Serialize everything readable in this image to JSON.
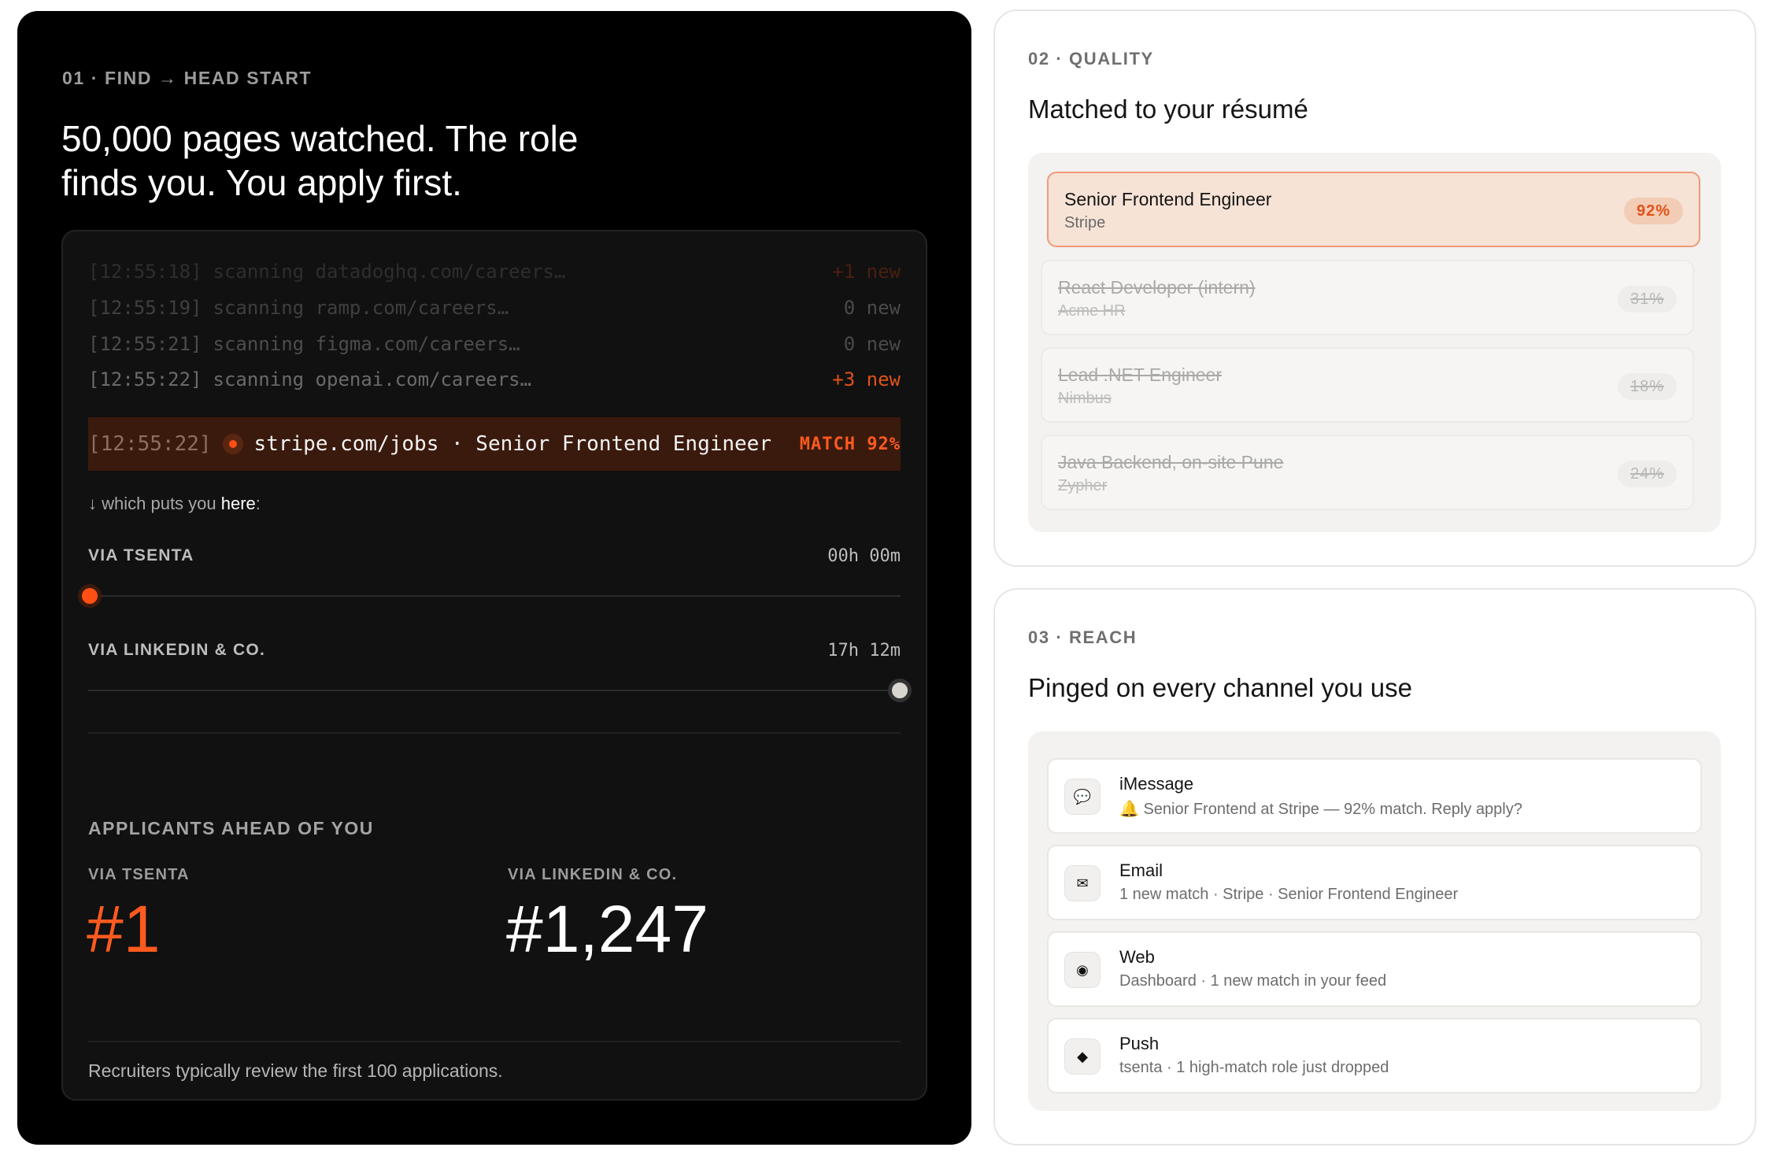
{
  "finder": {
    "eyebrow": "01 · FIND → HEAD START",
    "title": "50,000 pages watched. The role finds you. You apply first.",
    "log": [
      {
        "time": "[12:55:18]",
        "text": "scanning datadoghq.com/careers…",
        "result": "+1 new"
      },
      {
        "time": "[12:55:19]",
        "text": "scanning ramp.com/careers…",
        "result": "0 new"
      },
      {
        "time": "[12:55:21]",
        "text": "scanning figma.com/careers…",
        "result": "0 new"
      },
      {
        "time": "[12:55:22]",
        "text": "scanning openai.com/careers…",
        "result": "+3 new"
      }
    ],
    "hit": {
      "time": "[12:55:22]",
      "text": "stripe.com/jobs · Senior Frontend Engineer",
      "badge": "MATCH 92%"
    },
    "puts_prefix": "↓ which puts you ",
    "puts_here": "here",
    "puts_suffix": ":",
    "timeline": [
      {
        "label": "VIA TSENTA",
        "time": "00h 00m"
      },
      {
        "label": "VIA LINKEDIN & CO.",
        "time": "17h 12m"
      }
    ],
    "applicants_title": "APPLICANTS AHEAD OF YOU",
    "ranks": [
      {
        "label": "VIA TSENTA",
        "value": "#1"
      },
      {
        "label": "VIA LINKEDIN & CO.",
        "value": "#1,247"
      }
    ],
    "footnote": "Recruiters typically review the first 100 applications.",
    "colors": {
      "accent": "#ff5a1f",
      "background": "#000000",
      "panel": "#111111"
    }
  },
  "quality": {
    "eyebrow": "02 · QUALITY",
    "title": "Matched to your résumé",
    "matches": [
      {
        "title": "Senior Frontend Engineer",
        "company": "Stripe",
        "score": "92%"
      },
      {
        "title": "React Developer (intern)",
        "company": "Acme HR",
        "score": "31%"
      },
      {
        "title": "Lead .NET Engineer",
        "company": "Nimbus",
        "score": "18%"
      },
      {
        "title": "Java Backend, on-site Pune",
        "company": "Zypher",
        "score": "24%"
      }
    ]
  },
  "reach": {
    "eyebrow": "03 · REACH",
    "title": "Pinged on every channel you use",
    "channels": [
      {
        "icon": "speech-bubble-icon",
        "glyph": "💬",
        "name": "iMessage",
        "message": "🔔 Senior Frontend at Stripe — 92% match. Reply apply?"
      },
      {
        "icon": "envelope-icon",
        "glyph": "✉",
        "name": "Email",
        "message": "1 new match · Stripe · Senior Frontend Engineer"
      },
      {
        "icon": "radio-dot-icon",
        "glyph": "◉",
        "name": "Web",
        "message": "Dashboard · 1 new match in your feed"
      },
      {
        "icon": "diamond-icon",
        "glyph": "◆",
        "name": "Push",
        "message": "tsenta · 1 high-match role just dropped"
      }
    ]
  }
}
